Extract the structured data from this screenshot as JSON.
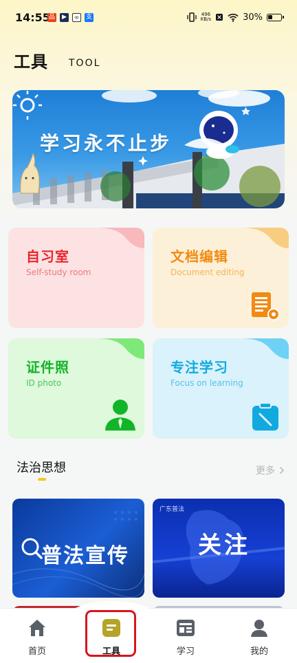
{
  "status_bar": {
    "time": "14:55",
    "net_speed_value": "496",
    "net_speed_unit": "KB/s",
    "battery": "30%"
  },
  "header": {
    "title": "工具",
    "subtitle": "TOOL"
  },
  "banner": {
    "text": "学习永不止步"
  },
  "tools": [
    {
      "title": "自习室",
      "subtitle": "Self-study room",
      "title_color": "#e8262c",
      "subtitle_color": "#e87b7b",
      "bg": "#fde2e3",
      "icon": "person-icon"
    },
    {
      "title": "文档编辑",
      "subtitle": "Document editing",
      "title_color": "#f28b12",
      "subtitle_color": "#f4b25a",
      "bg": "#fdf0d8",
      "icon": "document-gear-icon"
    },
    {
      "title": "证件照",
      "subtitle": "ID photo",
      "title_color": "#12b428",
      "subtitle_color": "#4bc55c",
      "bg": "#def9db",
      "icon": "id-photo-icon"
    },
    {
      "title": "专注学习",
      "subtitle": "Focus on learning",
      "title_color": "#12a9df",
      "subtitle_color": "#5bc1e6",
      "bg": "#d9f2fc",
      "icon": "clipboard-icon"
    }
  ],
  "section": {
    "title": "法治思想",
    "more": "更多"
  },
  "news": [
    {
      "title": "普法宣传"
    },
    {
      "title": "关注",
      "tag": "广东普法"
    }
  ],
  "nav": [
    {
      "label": "首页",
      "icon": "home-icon"
    },
    {
      "label": "工具",
      "icon": "tools-icon",
      "active": true
    },
    {
      "label": "学习",
      "icon": "study-icon"
    },
    {
      "label": "我的",
      "icon": "profile-icon"
    }
  ]
}
